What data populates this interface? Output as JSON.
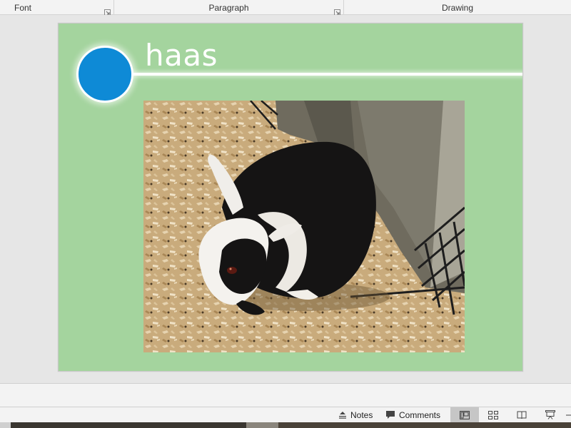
{
  "ribbon": {
    "groups": [
      {
        "label": "Font",
        "has_launcher": true
      },
      {
        "label": "Paragraph",
        "has_launcher": true
      },
      {
        "label": "Drawing",
        "has_launcher": false
      }
    ]
  },
  "slide": {
    "title": "haas",
    "accent_color": "#0e8ad6",
    "background_color": "#a4d49e",
    "photo_icon": "rabbit-photo"
  },
  "status_bar": {
    "notes_label": "Notes",
    "comments_label": "Comments",
    "views": [
      {
        "name": "normal-view",
        "icon": "normal-view-icon",
        "active": true
      },
      {
        "name": "slide-sorter-view",
        "icon": "slide-sorter-icon",
        "active": false
      },
      {
        "name": "reading-view",
        "icon": "reading-view-icon",
        "active": false
      },
      {
        "name": "slide-show-view",
        "icon": "slide-show-icon",
        "active": false
      }
    ]
  }
}
